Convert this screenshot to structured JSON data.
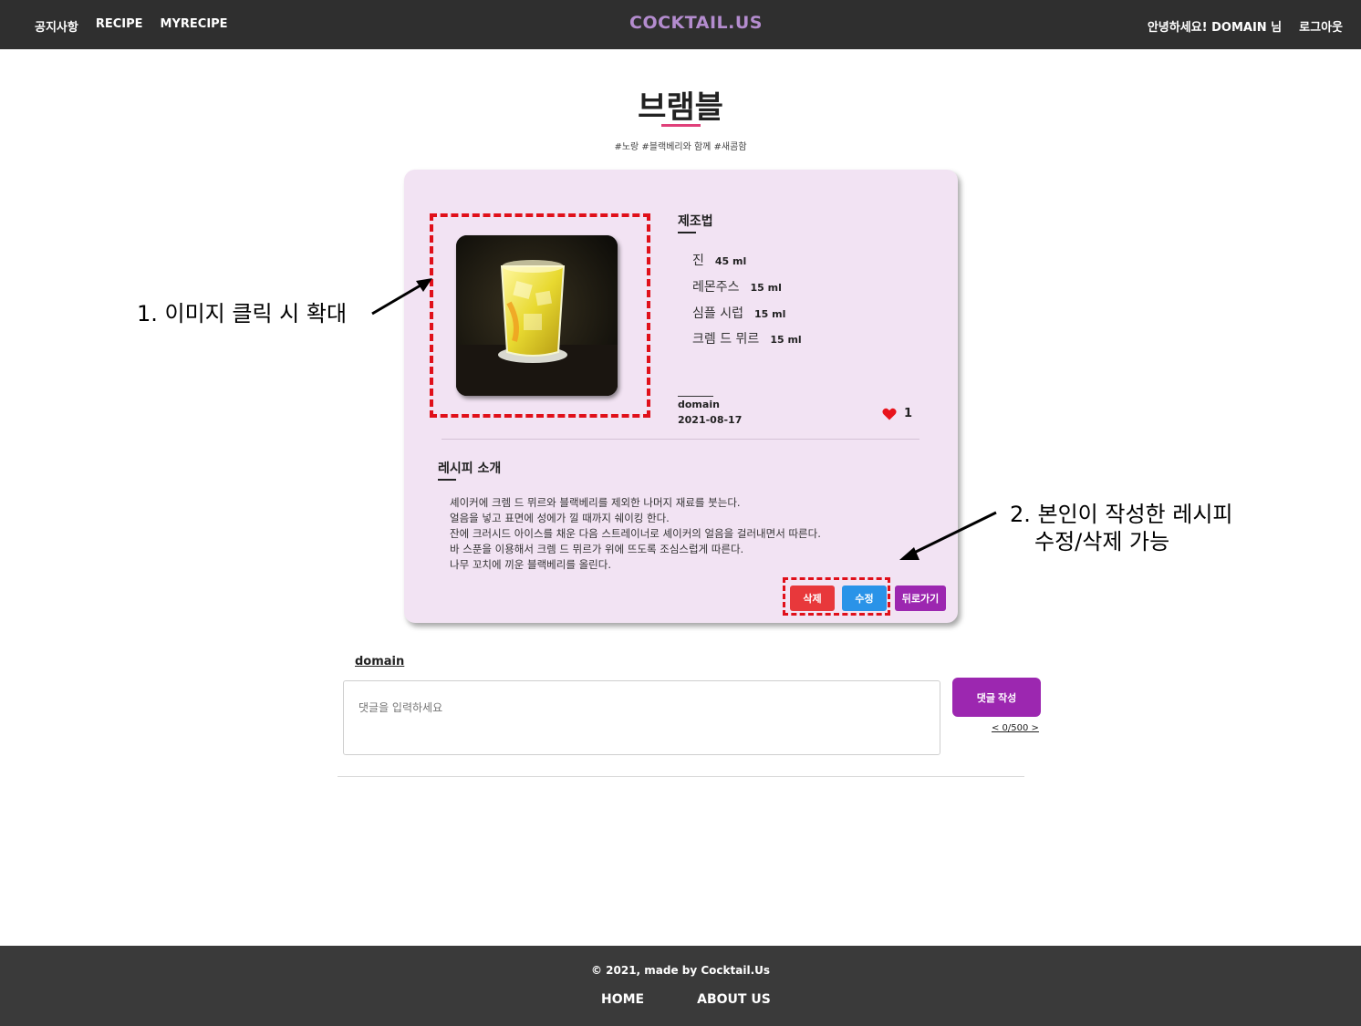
{
  "header": {
    "nav": [
      "공지사항",
      "RECIPE",
      "MYRECIPE"
    ],
    "logo": "COCKTAIL.US",
    "greeting": "안녕하세요! DOMAIN 님",
    "logout": "로그아웃"
  },
  "recipe": {
    "title": "브램블",
    "tags": "#노랑 #블랙베리와 함께 #새콤함",
    "method_heading": "제조법",
    "ingredients": [
      {
        "name": "진",
        "amount": "45 ml"
      },
      {
        "name": "레몬주스",
        "amount": "15 ml"
      },
      {
        "name": "심플 시럽",
        "amount": "15 ml"
      },
      {
        "name": "크렘 드 뮈르",
        "amount": "15 ml"
      }
    ],
    "author": "domain",
    "date": "2021-08-17",
    "likes": "1",
    "intro_heading": "레시피 소개",
    "intro_lines": [
      "셰이커에 크렘 드 뮈르와 블랙베리를 제외한 나머지 재료를 붓는다.",
      "얼음을 넣고 표면에 성에가 낄 때까지 쉐이킹 한다.",
      "잔에 크러시드 아이스를 채운 다음 스트레이너로 셰이커의 얼음을 걸러내면서 따른다.",
      "바 스푼을 이용해서 크렘 드 뮈르가 위에 뜨도록 조심스럽게 따른다.",
      "나무 꼬치에 끼운 블랙베리를 올린다."
    ],
    "buttons": {
      "delete": "삭제",
      "edit": "수정",
      "back": "뒤로가기"
    }
  },
  "annotations": {
    "image_note": "1. 이미지 클릭 시 확대",
    "edit_note_line1": "2. 본인이 작성한 레시피",
    "edit_note_line2": "수정/삭제 가능"
  },
  "comments": {
    "user": "domain",
    "placeholder": "댓글을 입력하세요",
    "submit": "댓글 작성",
    "count": "< 0/500 >"
  },
  "footer": {
    "copyright": "© 2021, made by Cocktail.Us",
    "links": [
      "HOME",
      "ABOUT US"
    ]
  },
  "colors": {
    "header_bg": "#2f2f2f",
    "card_bg": "#f2e3f3",
    "accent_pink": "#e0407a",
    "delete": "#e8383b",
    "edit": "#2a93e8",
    "purple": "#9c27b0",
    "annotation_red": "#e0101a"
  }
}
